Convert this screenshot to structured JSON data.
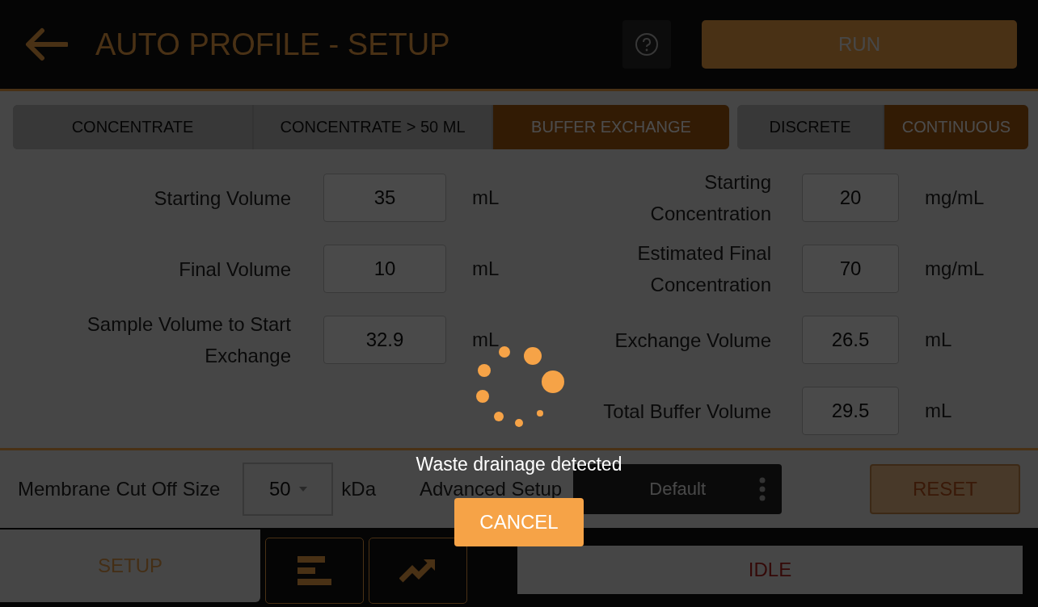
{
  "header": {
    "title": "AUTO PROFILE - SETUP",
    "run_label": "RUN"
  },
  "profile_tabs": [
    {
      "label": "CONCENTRATE",
      "selected": false
    },
    {
      "label": "CONCENTRATE > 50 ML",
      "selected": false
    },
    {
      "label": "BUFFER EXCHANGE",
      "selected": true
    }
  ],
  "mode_tabs": [
    {
      "label": "DISCRETE",
      "selected": false
    },
    {
      "label": "CONTINUOUS",
      "selected": true
    }
  ],
  "left_fields": [
    {
      "label": "Starting Volume",
      "value": "35",
      "unit": "mL"
    },
    {
      "label": "Final Volume",
      "value": "10",
      "unit": "mL"
    },
    {
      "label": "Sample Volume to Start Exchange",
      "value": "32.9",
      "unit": "mL"
    }
  ],
  "right_fields": [
    {
      "label": "Starting Concentration",
      "value": "20",
      "unit": "mg/mL"
    },
    {
      "label": "Estimated Final Concentration",
      "value": "70",
      "unit": "mg/mL"
    },
    {
      "label": "Exchange Volume",
      "value": "26.5",
      "unit": "mL"
    },
    {
      "label": "Total Buffer Volume",
      "value": "29.5",
      "unit": "mL"
    }
  ],
  "settings": {
    "membrane_label": "Membrane Cut Off Size",
    "membrane_value": "50",
    "membrane_unit": "kDa",
    "advanced_label": "Advanced Setup",
    "advanced_value": "Default",
    "reset_label": "RESET"
  },
  "footer": {
    "tab_label": "SETUP",
    "status": "IDLE"
  },
  "dialog": {
    "message": "Waste drainage detected",
    "cancel_label": "CANCEL"
  }
}
